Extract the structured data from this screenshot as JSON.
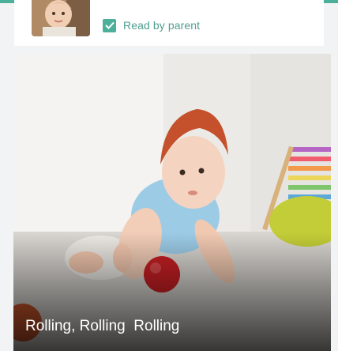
{
  "colors": {
    "accent": "#4caf9a",
    "accent_text": "#4f9e8f"
  },
  "previous_card": {
    "thumbnail_icon": "baby-photo",
    "read_status": {
      "checked": true,
      "label": "Read by parent"
    }
  },
  "story_card": {
    "image_icon": "crawling-baby-photo",
    "title": "Rolling, Rolling  Rolling"
  }
}
